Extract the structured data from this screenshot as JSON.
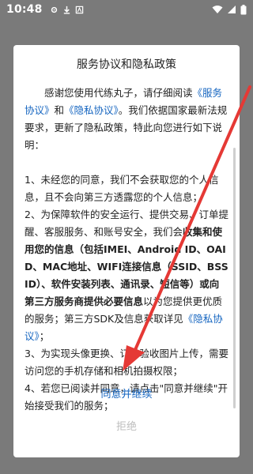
{
  "status_bar": {
    "time": "10:48"
  },
  "dialog": {
    "title": "服务协议和隐私政策",
    "intro": {
      "prefix": "感谢您使用代练丸子，请仔细阅读",
      "service_link": "《服务协议》",
      "and": "和",
      "privacy_link": "《隐私协议》",
      "suffix": "。我们依据国家最新法规要求，更新了隐私政策，特此向您进行如下说明："
    },
    "item1": "1、未经您的同意，我们不会获取您的个人信息，且不会向第三方透露您的个人信息；",
    "item2": {
      "text_a": "2、为保障软件的安全运行、提供交易、订单提醒、客服服务、和账号安全，我们会",
      "bold_a": "收集和使用您的信息（包括IMEI、Android ID、OAID、MAC地址、WIFI连接信息（SSID、BSSID）、软件安装列表、通讯录、短信等）或向第三方服务商提供必要信息",
      "text_b": "以为您提供更优质的服务；第三方SDK及信息获取详见",
      "privacy_link": "《隐私协议》",
      "text_c": "；"
    },
    "item3": "3、为实现头像更换、订单验收图片上传，需要访问您的手机存储和相机拍摄权限；",
    "item4": "4、若您已阅读并同意，请点击\"同意并继续\"开始接受我们的服务；",
    "agree_label": "同意并继续",
    "reject_label": "拒绝"
  },
  "colors": {
    "link": "#1565c0",
    "annotation_arrow": "#e53935",
    "overlay": "#7a7a7a",
    "reject": "#bdbdbd"
  }
}
